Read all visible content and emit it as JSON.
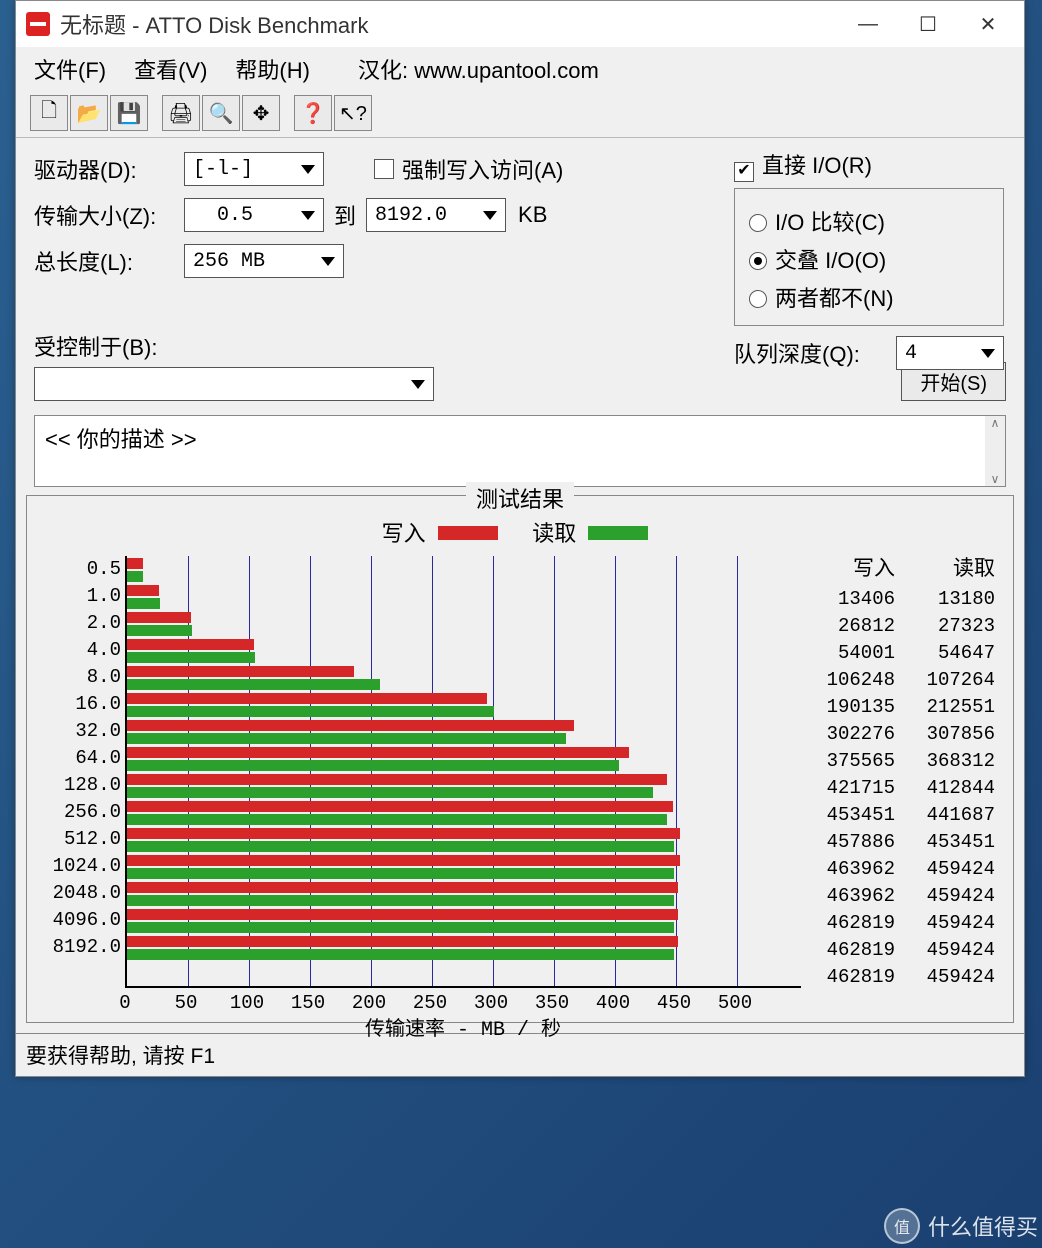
{
  "window": {
    "title": "无标题 - ATTO Disk Benchmark",
    "min": "—",
    "max": "☐",
    "close": "✕"
  },
  "menu": {
    "file": "文件(F)",
    "view": "查看(V)",
    "help": "帮助(H)",
    "credit": "汉化: www.upantool.com"
  },
  "toolbar": {
    "new": "🗋",
    "open": "📂",
    "save": "💾",
    "print": "🖨",
    "preview": "🔍",
    "move": "✥",
    "q": "❓",
    "wq": "↖?"
  },
  "form": {
    "drive_label": "驱动器(D):",
    "drive_value": "[-l-]",
    "xfer_label": "传输大小(Z):",
    "xfer_from": "0.5",
    "xfer_to_label": "到",
    "xfer_to": "8192.0",
    "xfer_unit": "KB",
    "length_label": "总长度(L):",
    "length_value": "256 MB",
    "force_label": "强制写入访问(A)",
    "direct_label": "直接 I/O(R)",
    "direct_checked": "✔",
    "io_compare": "I/O 比较(C)",
    "io_overlap": "交叠 I/O(O)",
    "io_neither": "两者都不(N)",
    "qd_label": "队列深度(Q):",
    "qd_value": "4",
    "controlled_label": "受控制于(B):",
    "controlled_value": "",
    "start": "开始(S)",
    "desc_placeholder": "<<  你的描述   >>"
  },
  "results": {
    "title": "测试结果",
    "write_label": "写入",
    "read_label": "读取",
    "axis_label": "传输速率 - MB / 秒"
  },
  "chart_data": {
    "type": "bar",
    "xlabel": "传输速率 - MB / 秒",
    "ylabel": "",
    "xlim": [
      0,
      500
    ],
    "xticks": [
      0,
      50,
      100,
      150,
      200,
      250,
      300,
      350,
      400,
      450,
      500
    ],
    "categories": [
      "0.5",
      "1.0",
      "2.0",
      "4.0",
      "8.0",
      "16.0",
      "32.0",
      "64.0",
      "128.0",
      "256.0",
      "512.0",
      "1024.0",
      "2048.0",
      "4096.0",
      "8192.0"
    ],
    "series": [
      {
        "name": "写入",
        "color": "#d62728",
        "values_kb": [
          13406,
          26812,
          54001,
          106248,
          190135,
          302276,
          375565,
          421715,
          453451,
          457886,
          463962,
          463962,
          462819,
          462819,
          462819
        ]
      },
      {
        "name": "读取",
        "color": "#2ca02c",
        "values_kb": [
          13180,
          27323,
          54647,
          107264,
          212551,
          307856,
          368312,
          412844,
          441687,
          453451,
          459424,
          459424,
          459424,
          459424,
          459424
        ]
      }
    ],
    "display_scale": "values shown in KB/s columns; bar lengths ≈ MB/s"
  },
  "status": "要获得帮助, 请按 F1",
  "watermark": "什么值得买"
}
